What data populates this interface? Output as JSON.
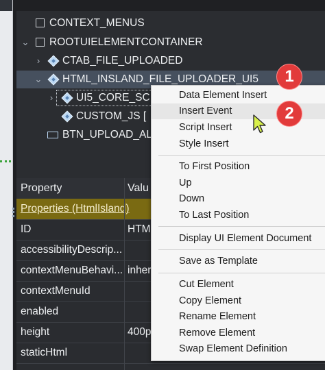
{
  "tree": {
    "items": [
      {
        "label": "CONTEXT_MENUS"
      },
      {
        "label": "ROOTUIELEMENTCONTAINER"
      },
      {
        "label": "CTAB_FILE_UPLOADED"
      },
      {
        "label": "HTML_INSLAND_FILE_UPLOADER_UI5"
      },
      {
        "label": "UI5_CORE_SCI"
      },
      {
        "label": "CUSTOM_JS ["
      },
      {
        "label": "BTN_UPLOAD_AL"
      }
    ]
  },
  "properties": {
    "headers": {
      "property": "Property",
      "value": "Valu"
    },
    "group_label": "Properties (HtmlIsland)",
    "rows": [
      {
        "name": "ID",
        "value": "HTM"
      },
      {
        "name": "accessibilityDescrip...",
        "value": ""
      },
      {
        "name": "contextMenuBehavi...",
        "value": "inher"
      },
      {
        "name": "contextMenuId",
        "value": ""
      },
      {
        "name": "enabled",
        "value": ""
      },
      {
        "name": "height",
        "value": "400p"
      },
      {
        "name": "staticHtml",
        "value": ""
      }
    ]
  },
  "context_menu": {
    "groups": [
      [
        "Data Element Insert",
        "Insert Event",
        "Script Insert",
        "Style Insert"
      ],
      [
        "To First Position",
        "Up",
        "Down",
        "To Last Position"
      ],
      [
        "Display UI Element Document"
      ],
      [
        "Save as Template"
      ],
      [
        "Cut Element",
        "Copy Element",
        "Rename Element",
        "Remove Element",
        "Swap Element Definition"
      ]
    ]
  },
  "badges": {
    "step1": "1",
    "step2": "2"
  },
  "colors": {
    "selection": "#46505e",
    "group_row": "#7a6a12",
    "badge": "#e23b3b",
    "menu_bg": "#f6f6f6"
  },
  "icons": {
    "node": "diamond-icon",
    "container": "checkbox-icon",
    "button": "button-element-icon",
    "expand": "chevron-right-icon",
    "collapse": "chevron-down-icon"
  }
}
